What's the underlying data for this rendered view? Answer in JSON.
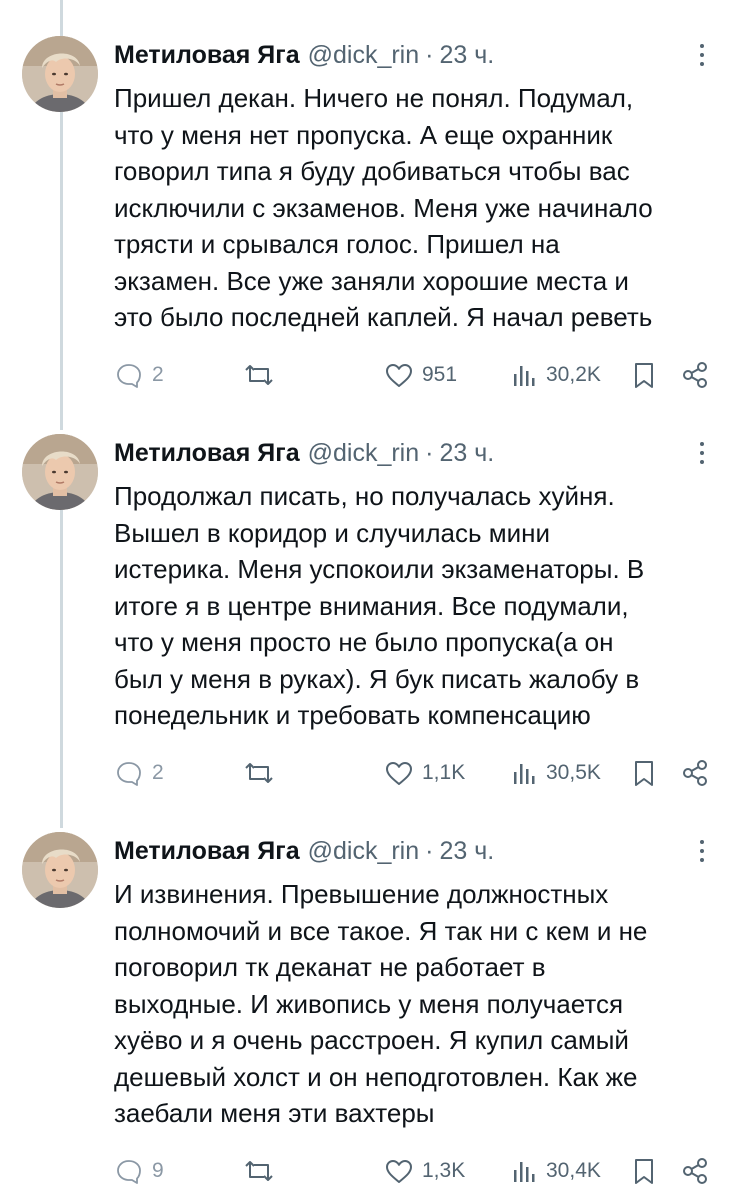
{
  "tweets": [
    {
      "author_name": "Метиловая Яга",
      "handle": "@dick_rin",
      "separator": "·",
      "time": "23 ч.",
      "text": "Пришел декан. Ничего не понял. Подумал,\nчто у меня нет пропуска. А еще охранник\nговорил типа я буду добиваться чтобы вас\nисключили с экзаменов. Меня уже начинало\nтрясти и срывался голос. Пришел на\nэкзамен. Все уже заняли хорошие места и\nэто было последней каплей. Я начал реветь",
      "replies": "2",
      "likes": "951",
      "views": "30,2K"
    },
    {
      "author_name": "Метиловая Яга",
      "handle": "@dick_rin",
      "separator": "·",
      "time": "23 ч.",
      "text": "Продолжал писать, но получалась хуйня.\nВышел в коридор и случилась мини\nистерика. Меня успокоили экзаменаторы. В\nитоге я в центре внимания. Все подумали,\nчто у меня просто не было пропуска(а он\nбыл у меня в руках). Я бук писать жалобу в\nпонедельник и требовать компенсацию",
      "replies": "2",
      "likes": "1,1K",
      "views": "30,5K"
    },
    {
      "author_name": "Метиловая Яга",
      "handle": "@dick_rin",
      "separator": "·",
      "time": "23 ч.",
      "text": "И извинения. Превышение должностных\nполномочий и все такое. Я так ни с кем и не\nпоговорил тк деканат не работает в\nвыходные. И живопись у меня получается\nхуёво и я очень расстроен. Я купил самый\nдешевый холст и он неподготовлен. Как же\nзаебали меня эти вахтеры",
      "replies": "9",
      "likes": "1,3K",
      "views": "30,4K"
    }
  ],
  "icons": {
    "reply": "speech-bubble-icon",
    "repost": "repost-arrows-icon",
    "like": "heart-icon",
    "views": "bar-chart-icon",
    "bookmark": "bookmark-icon",
    "share": "share-icon",
    "more": "vertical-dots-icon"
  },
  "colors": {
    "text": "#0f1419",
    "secondary": "#536471",
    "thread_line": "#cfd9de",
    "background": "#ffffff"
  }
}
